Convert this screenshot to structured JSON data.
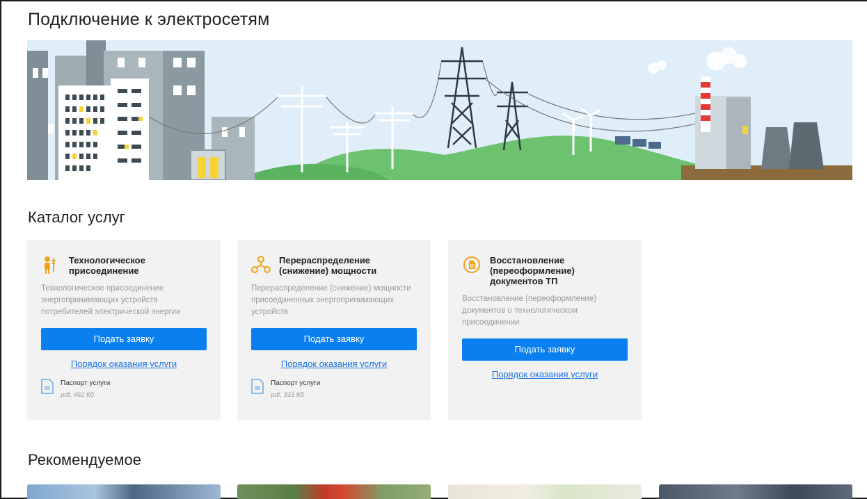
{
  "page": {
    "title": "Подключение к электросетям"
  },
  "catalog": {
    "title": "Каталог услуг",
    "cards": [
      {
        "icon": "worker-icon",
        "title": "Технологическое присоединение",
        "description": "Технологическое присоединение энергопринимающих устройств потребителей электрической энергии",
        "button_label": "Подать заявку",
        "order_link": "Порядок оказания услуги",
        "passport_label": "Паспорт услуги",
        "passport_meta": "pdf, 492 Кб"
      },
      {
        "icon": "power-distribution-icon",
        "title": "Перераспределение (снижение) мощности",
        "description": "Перераспределение (снижение) мощности присоединенных энергопринимающих устройств",
        "button_label": "Подать заявку",
        "order_link": "Порядок оказания услуги",
        "passport_label": "Паспорт услуги",
        "passport_meta": "pdf, 333 Кб"
      },
      {
        "icon": "document-restore-icon",
        "title": "Восстановление (переоформление) документов ТП",
        "description": "Восстановление (переоформление) документов о технологическом присоединении",
        "button_label": "Подать заявку",
        "order_link": "Порядок оказания услуги"
      }
    ]
  },
  "recommended": {
    "title": "Рекомендуемое"
  },
  "colors": {
    "accent": "#0a7ff0",
    "link": "#1a73e8",
    "card_bg": "#f2f2f2",
    "icon_orange": "#f0a21a"
  }
}
